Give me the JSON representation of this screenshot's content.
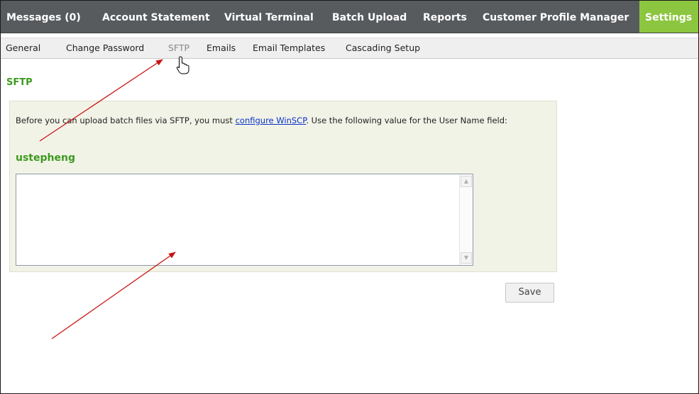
{
  "topnav": {
    "items": [
      {
        "label": "Messages (0)"
      },
      {
        "label": "Account Statement"
      },
      {
        "label": "Virtual Terminal"
      },
      {
        "label": "Batch Upload"
      },
      {
        "label": "Reports"
      },
      {
        "label": "Customer Profile Manager"
      },
      {
        "label": "Settings"
      }
    ],
    "active_color": "#8cc640"
  },
  "subnav": {
    "items": [
      {
        "label": "General"
      },
      {
        "label": "Change Password"
      },
      {
        "label": "SFTP"
      },
      {
        "label": "Emails"
      },
      {
        "label": "Email Templates"
      },
      {
        "label": "Cascading Setup"
      }
    ],
    "current": "SFTP"
  },
  "section": {
    "title": "SFTP",
    "desc_before": "Before you can upload batch files via SFTP, you must ",
    "link_text": "configure WinSCP",
    "desc_after": ". Use the following value for the User Name field:",
    "username": "ustepheng"
  },
  "save_label": "Save",
  "icons": {
    "scroll_up": "scroll-up-arrow-icon",
    "scroll_down": "scroll-down-arrow-icon",
    "cursor": "hand-pointer-icon"
  },
  "colors": {
    "accent_green": "#3c9a1e",
    "nav_bg": "#585b5e",
    "panel_bg": "#f2f3e7",
    "annotation_red": "#c81414"
  }
}
